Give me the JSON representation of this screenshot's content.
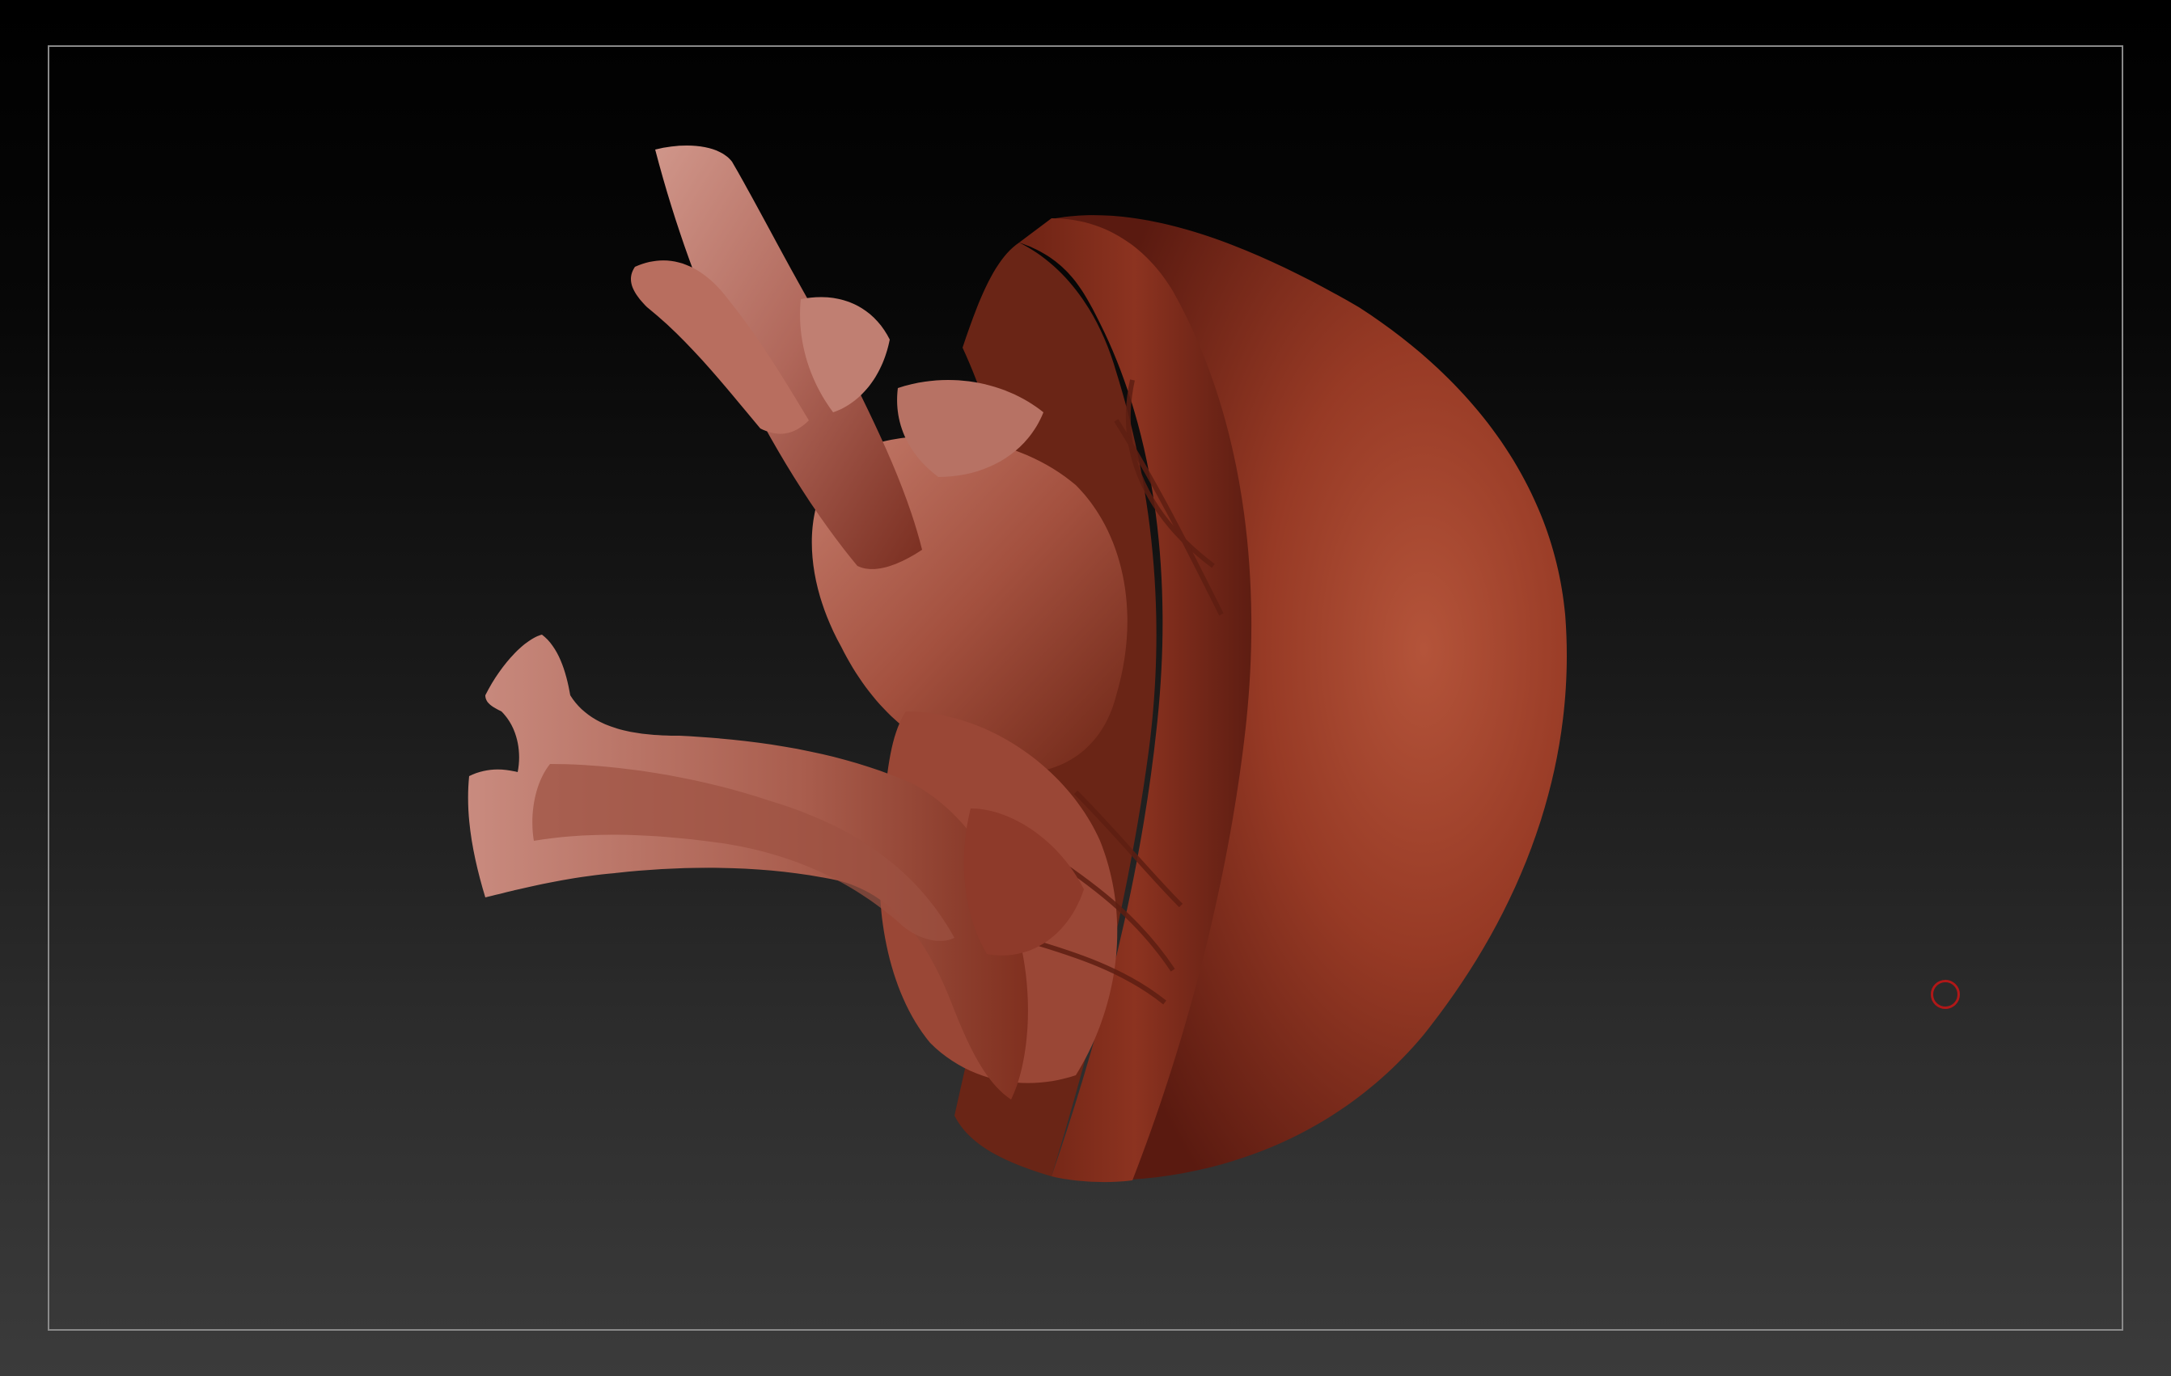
{
  "canvas": {
    "background_top": "#000000",
    "background_bottom": "#3b3b3b",
    "frame_color": "#8a8a8a"
  },
  "model": {
    "material_color": "#8e3523",
    "highlight_color": "#c2786a",
    "shadow_color": "#4a140c"
  },
  "brush_cursor": {
    "color": "#b01818"
  }
}
